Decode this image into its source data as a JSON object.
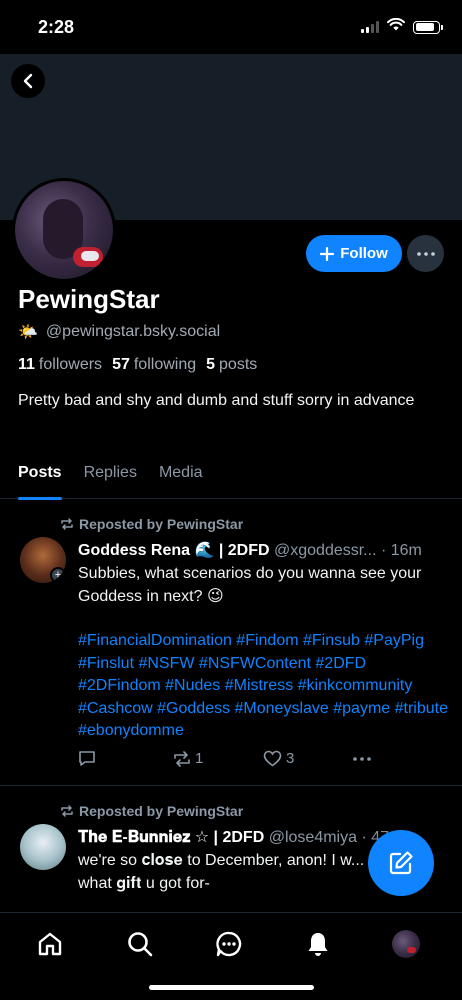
{
  "status": {
    "time": "2:28",
    "battery_level": 0.85
  },
  "profile": {
    "display_name": "PewingStar",
    "handle": "@pewingstar.bsky.social",
    "handle_emoji": "🌤️",
    "followers_count": "11",
    "followers_label": "followers",
    "following_count": "57",
    "following_label": "following",
    "posts_count": "5",
    "posts_label": "posts",
    "bio": "Pretty bad and shy and dumb and stuff sorry in advance",
    "follow_label": "Follow"
  },
  "tabs": [
    {
      "label": "Posts",
      "active": true
    },
    {
      "label": "Replies",
      "active": false
    },
    {
      "label": "Media",
      "active": false
    }
  ],
  "posts": [
    {
      "repost_label": "Reposted by PewingStar",
      "author_name": "Goddess Rena 🌊 | 2DFD",
      "author_handle": "@xgoddessr...",
      "time": "· 16m",
      "text": "Subbies, what scenarios do you wanna see your Goddess in next? 😉",
      "hashtags": "#FinancialDomination #Findom #Finsub #PayPig #Finslut #NSFW #NSFWContent #2DFD #2DFindom #Nudes #Mistress #kinkcommunity #Cashcow #Goddess #Moneyslave #payme #tribute #ebonydomme",
      "reposts": "1",
      "likes": "3"
    },
    {
      "repost_label": "Reposted by PewingStar",
      "author_name": "𝐓𝐡𝐞 𝐄-𝐁𝐮𝐧𝐧𝐢𝐞𝐳 ☆ | 2DFD",
      "author_handle": "@lose4miya",
      "time": "· 47m",
      "text": "we're so 𝐜𝐥𝐨𝐬𝐞 to December, anon! I w... what 𝐠𝐢𝐟𝐭 u got for-"
    }
  ],
  "colors": {
    "accent": "#1083fe",
    "banner": "#161e27",
    "muted": "#8b98a5"
  }
}
